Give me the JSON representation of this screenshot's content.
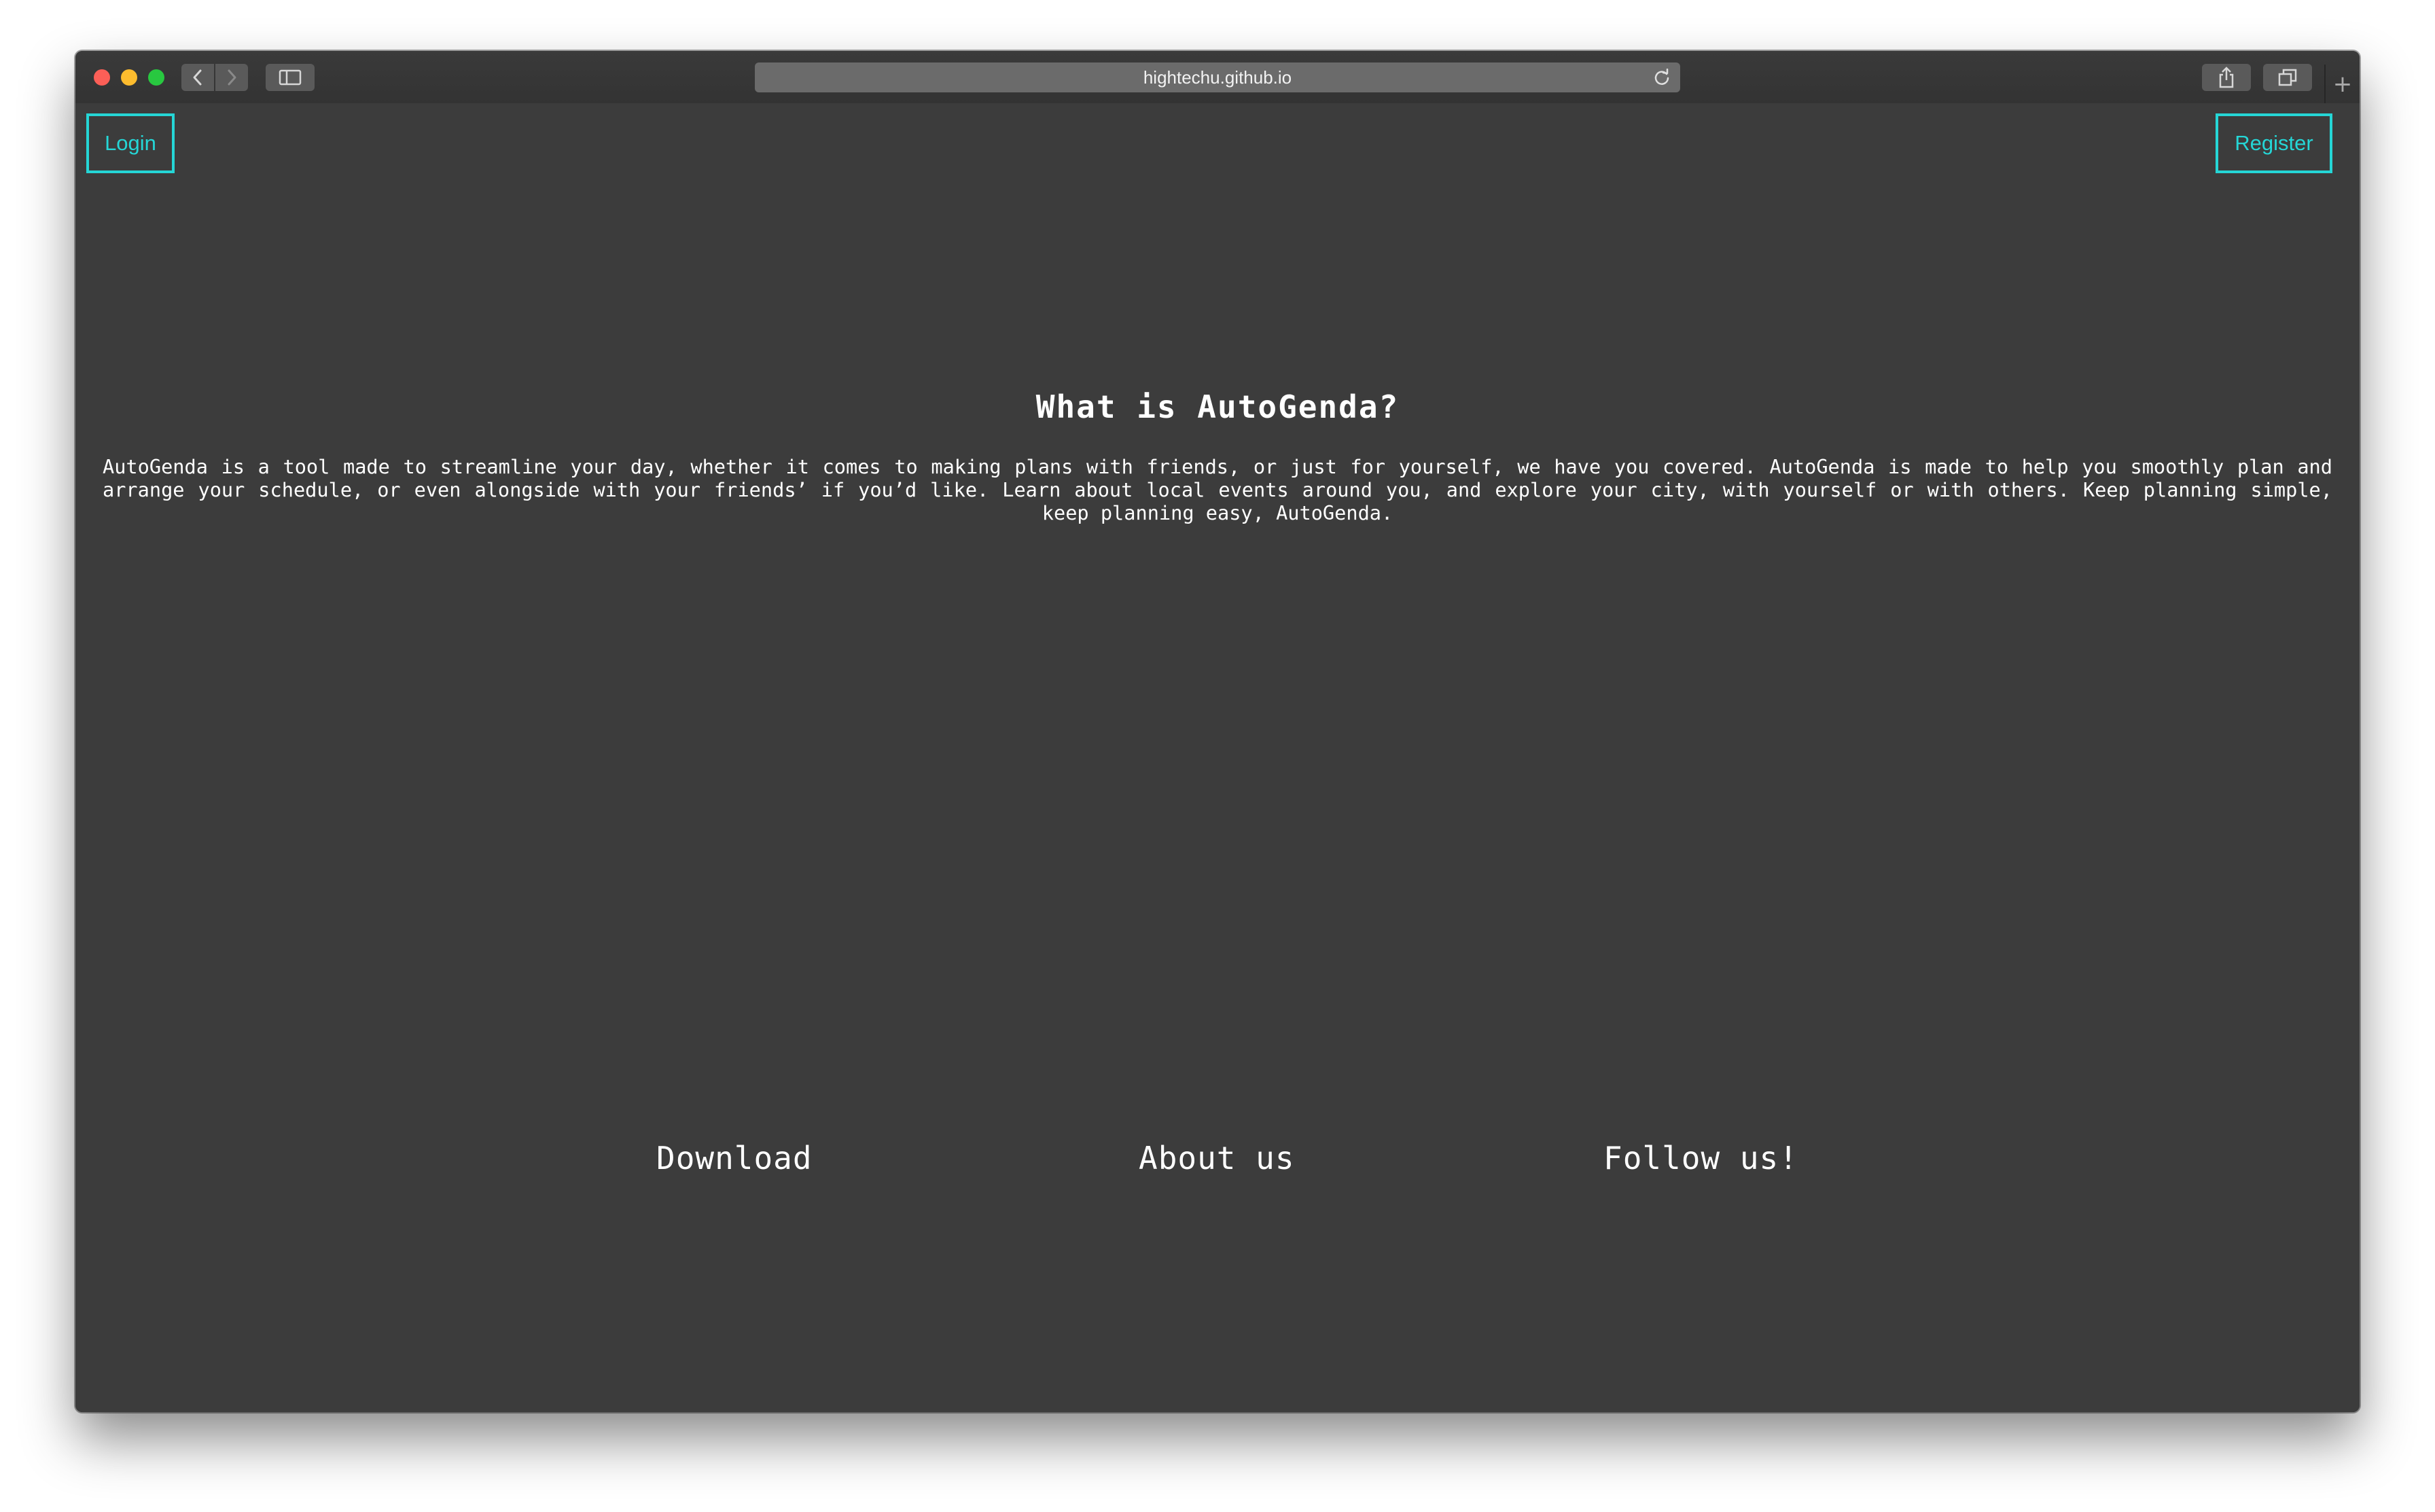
{
  "browser": {
    "url": "hightechu.github.io",
    "icons": {
      "back": "chevron-left-icon",
      "forward": "chevron-right-icon",
      "sidebar": "sidebar-icon",
      "reload": "reload-icon",
      "share": "share-icon",
      "tabs": "tabs-overview-icon",
      "new_tab": "plus-icon"
    },
    "new_tab_glyph": "+"
  },
  "header": {
    "login_label": "Login",
    "register_label": "Register"
  },
  "main": {
    "heading": "What is AutoGenda?",
    "description": "AutoGenda is a tool made to streamline your day, whether it comes to making plans with friends, or just for yourself, we have you covered. AutoGenda is made to help you smoothly plan and arrange your schedule, or even alongside with your friends’ if you’d like. Learn about local events around you, and explore your city, with yourself or with others. Keep planning simple, keep planning easy, AutoGenda."
  },
  "footer": {
    "download_label": "Download",
    "about_label": "About us",
    "follow_label": "Follow us!"
  },
  "colors": {
    "page_background": "#3c3c3c",
    "accent": "#25d6d6",
    "text": "#ffffff"
  }
}
